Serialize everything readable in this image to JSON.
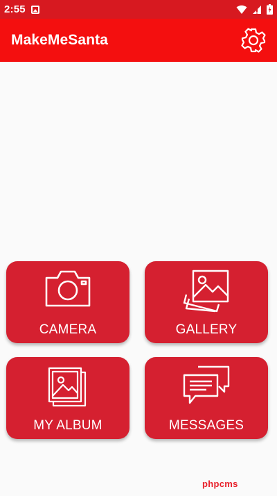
{
  "status_bar": {
    "time": "2:55",
    "icons": [
      "notification-icon",
      "wifi-icon",
      "signal-icon",
      "battery-icon"
    ]
  },
  "app_bar": {
    "title": "MakeMeSanta",
    "settings_icon": "gear-icon"
  },
  "tiles": [
    {
      "label": "CAMERA",
      "icon": "camera-icon"
    },
    {
      "label": "GALLERY",
      "icon": "gallery-icon"
    },
    {
      "label": "MY ALBUM",
      "icon": "album-icon"
    },
    {
      "label": "MESSAGES",
      "icon": "messages-icon"
    }
  ],
  "watermark": "phpcms",
  "colors": {
    "status_bar": "#d71920",
    "app_bar": "#f40f0f",
    "tile": "#d52030",
    "background": "#fafafa"
  }
}
